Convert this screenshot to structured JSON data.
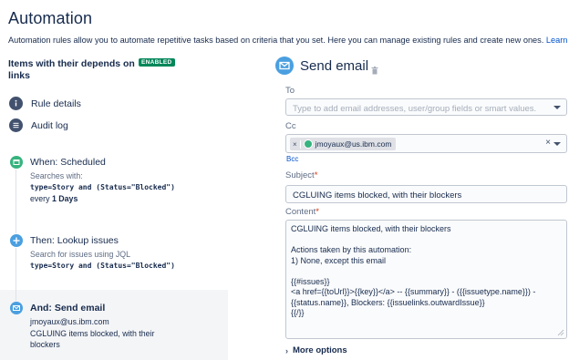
{
  "page": {
    "title": "Automation",
    "intro_text": "Automation rules allow you to automate repetitive tasks based on criteria that you set. Here you can manage existing rules and create new ones. ",
    "learn_more": "Learn more a"
  },
  "rule": {
    "name": "Items with their depends on links",
    "status_badge": "ENABLED"
  },
  "nav": {
    "rule_details": "Rule details",
    "audit_log": "Audit log"
  },
  "steps": {
    "trigger": {
      "title": "When: Scheduled",
      "sub": "Searches with:",
      "jql": "type=Story and (Status=\"Blocked\")",
      "every_prefix": "every ",
      "every_value": "1 Days"
    },
    "lookup": {
      "title": "Then: Lookup issues",
      "sub": "Search for issues using JQL",
      "jql": "type=Story and (Status=\"Blocked\")"
    },
    "send_email": {
      "title": "And: Send email",
      "to": "jmoyaux@us.ibm.com",
      "desc_line1": "CGLUING items blocked, with their",
      "desc_line2": "blockers"
    }
  },
  "action": {
    "title": "Send email",
    "to_label": "To",
    "to_placeholder": "Type to add email addresses, user/group fields or smart values.",
    "cc_label": "Cc",
    "cc_chip": "jmoyaux@us.ibm.com",
    "bcc_link": "Bcc",
    "subject_label": "Subject",
    "subject_value": "CGLUING items blocked, with their blockers",
    "content_label": "Content",
    "content_lines": [
      "CGLUING items blocked, with their blockers",
      "",
      "Actions taken by this automation:",
      "1) None, except this email",
      "",
      "{{#issues}}",
      "<a href={{toUrl}}>{{key}}</a> -- {{summary}} - ({{issuetype.name}}) -",
      "{{status.name}}, Blockers: {{issuelinks.outwardIssue}}",
      "{{/}}"
    ],
    "more_options": "More options"
  },
  "colors": {
    "enabled_badge": "#00875a",
    "trigger_icon": "#36b37e",
    "lookup_icon": "#4a9fe0",
    "action_icon": "#4a9fe0",
    "nav_icon": "#42526e",
    "link": "#0052cc",
    "required": "#de350b"
  },
  "icons": {
    "rule_details": "info-icon",
    "audit_log": "list-icon",
    "trigger": "calendar-icon",
    "lookup": "plus-icon",
    "action": "envelope-icon",
    "delete": "trash-icon"
  }
}
